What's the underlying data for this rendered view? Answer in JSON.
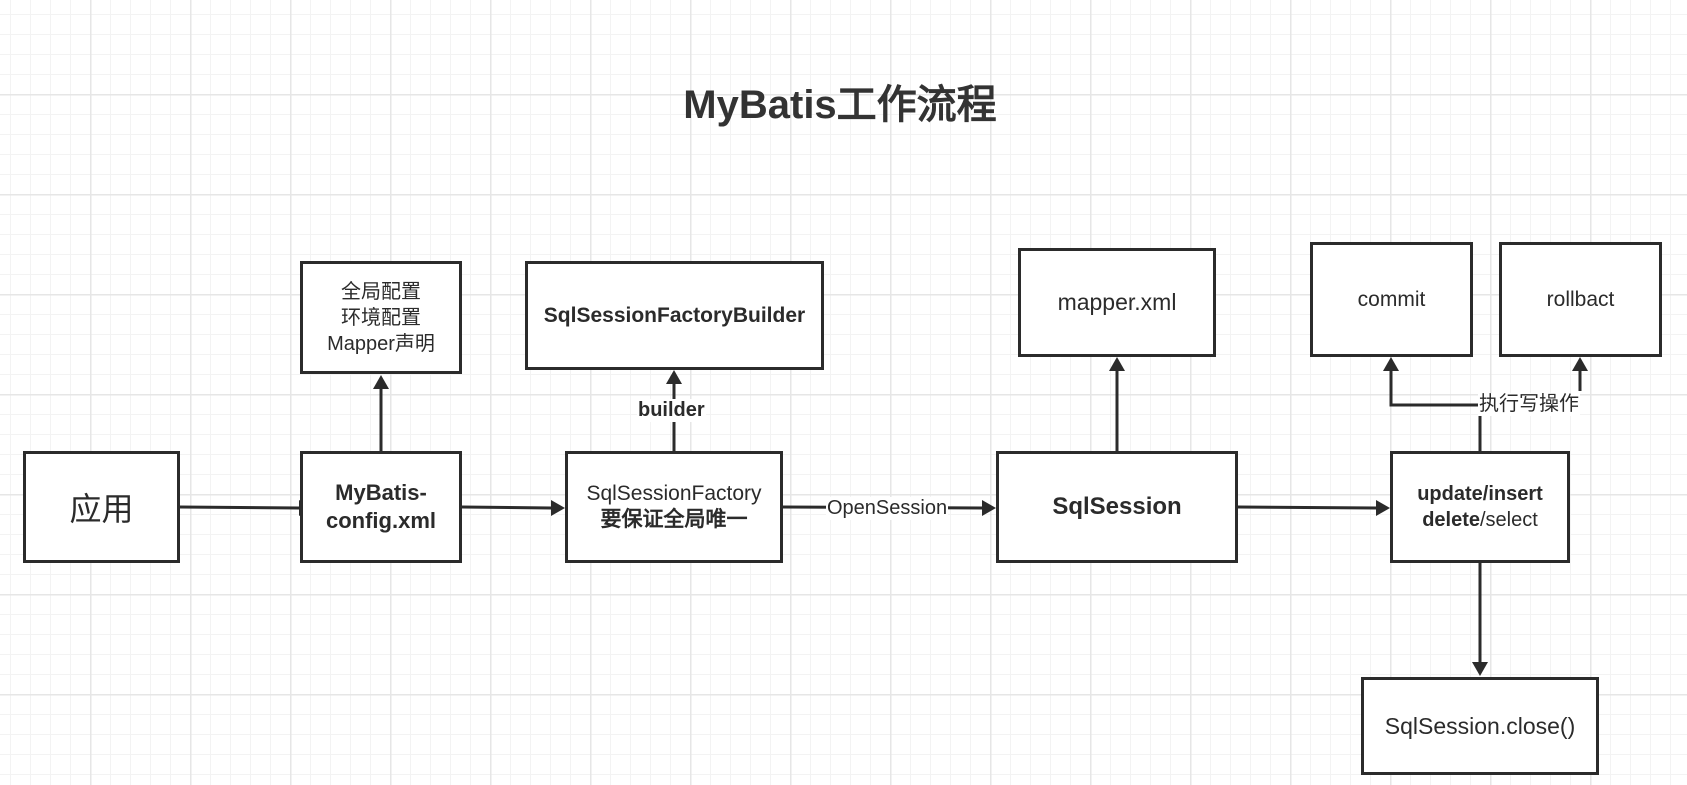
{
  "title": "MyBatis工作流程",
  "nodes": {
    "app": {
      "label": "应用"
    },
    "config_notes": {
      "lines": [
        "全局配置",
        "环境配置",
        "Mapper声明"
      ]
    },
    "config": {
      "lines": [
        "MyBatis-",
        "config.xml"
      ]
    },
    "builder": {
      "label": "SqlSessionFactoryBuilder"
    },
    "factory": {
      "line1": "SqlSessionFactory",
      "line2": "要保证全局唯一"
    },
    "mapper": {
      "label": "mapper.xml"
    },
    "session": {
      "label": "SqlSession"
    },
    "commit": {
      "label": "commit"
    },
    "rollback": {
      "label": "rollbact"
    },
    "operations": {
      "line1": "update/insert",
      "line2_bold": "delete",
      "line2_rest": "/select"
    },
    "close": {
      "label": "SqlSession.close()"
    }
  },
  "edges": {
    "builder_label": "builder",
    "open_session_label": "OpenSession",
    "write_label": "执行写操作"
  },
  "colors": {
    "stroke": "#2b2b2b",
    "grid_major": "#e6e6e6",
    "grid_minor": "#f3f3f3",
    "background": "#ffffff"
  }
}
